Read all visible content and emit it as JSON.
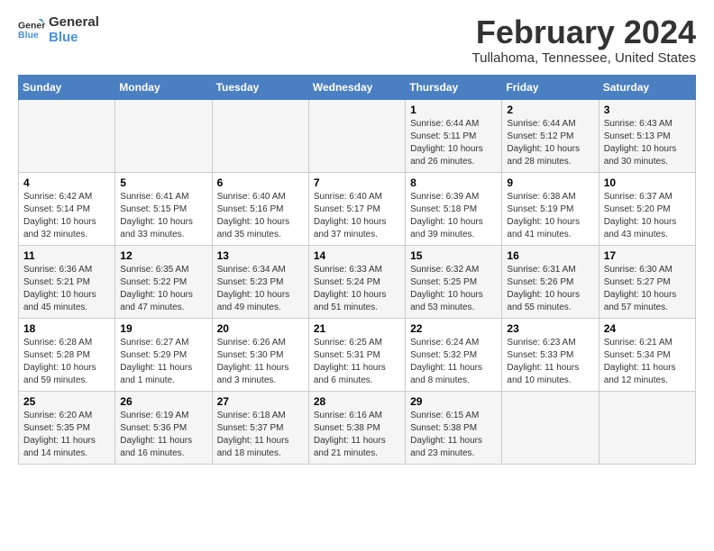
{
  "logo": {
    "text_general": "General",
    "text_blue": "Blue"
  },
  "header": {
    "title": "February 2024",
    "subtitle": "Tullahoma, Tennessee, United States"
  },
  "columns": [
    "Sunday",
    "Monday",
    "Tuesday",
    "Wednesday",
    "Thursday",
    "Friday",
    "Saturday"
  ],
  "weeks": [
    [
      {
        "day": "",
        "info": ""
      },
      {
        "day": "",
        "info": ""
      },
      {
        "day": "",
        "info": ""
      },
      {
        "day": "",
        "info": ""
      },
      {
        "day": "1",
        "info": "Sunrise: 6:44 AM\nSunset: 5:11 PM\nDaylight: 10 hours\nand 26 minutes."
      },
      {
        "day": "2",
        "info": "Sunrise: 6:44 AM\nSunset: 5:12 PM\nDaylight: 10 hours\nand 28 minutes."
      },
      {
        "day": "3",
        "info": "Sunrise: 6:43 AM\nSunset: 5:13 PM\nDaylight: 10 hours\nand 30 minutes."
      }
    ],
    [
      {
        "day": "4",
        "info": "Sunrise: 6:42 AM\nSunset: 5:14 PM\nDaylight: 10 hours\nand 32 minutes."
      },
      {
        "day": "5",
        "info": "Sunrise: 6:41 AM\nSunset: 5:15 PM\nDaylight: 10 hours\nand 33 minutes."
      },
      {
        "day": "6",
        "info": "Sunrise: 6:40 AM\nSunset: 5:16 PM\nDaylight: 10 hours\nand 35 minutes."
      },
      {
        "day": "7",
        "info": "Sunrise: 6:40 AM\nSunset: 5:17 PM\nDaylight: 10 hours\nand 37 minutes."
      },
      {
        "day": "8",
        "info": "Sunrise: 6:39 AM\nSunset: 5:18 PM\nDaylight: 10 hours\nand 39 minutes."
      },
      {
        "day": "9",
        "info": "Sunrise: 6:38 AM\nSunset: 5:19 PM\nDaylight: 10 hours\nand 41 minutes."
      },
      {
        "day": "10",
        "info": "Sunrise: 6:37 AM\nSunset: 5:20 PM\nDaylight: 10 hours\nand 43 minutes."
      }
    ],
    [
      {
        "day": "11",
        "info": "Sunrise: 6:36 AM\nSunset: 5:21 PM\nDaylight: 10 hours\nand 45 minutes."
      },
      {
        "day": "12",
        "info": "Sunrise: 6:35 AM\nSunset: 5:22 PM\nDaylight: 10 hours\nand 47 minutes."
      },
      {
        "day": "13",
        "info": "Sunrise: 6:34 AM\nSunset: 5:23 PM\nDaylight: 10 hours\nand 49 minutes."
      },
      {
        "day": "14",
        "info": "Sunrise: 6:33 AM\nSunset: 5:24 PM\nDaylight: 10 hours\nand 51 minutes."
      },
      {
        "day": "15",
        "info": "Sunrise: 6:32 AM\nSunset: 5:25 PM\nDaylight: 10 hours\nand 53 minutes."
      },
      {
        "day": "16",
        "info": "Sunrise: 6:31 AM\nSunset: 5:26 PM\nDaylight: 10 hours\nand 55 minutes."
      },
      {
        "day": "17",
        "info": "Sunrise: 6:30 AM\nSunset: 5:27 PM\nDaylight: 10 hours\nand 57 minutes."
      }
    ],
    [
      {
        "day": "18",
        "info": "Sunrise: 6:28 AM\nSunset: 5:28 PM\nDaylight: 10 hours\nand 59 minutes."
      },
      {
        "day": "19",
        "info": "Sunrise: 6:27 AM\nSunset: 5:29 PM\nDaylight: 11 hours\nand 1 minute."
      },
      {
        "day": "20",
        "info": "Sunrise: 6:26 AM\nSunset: 5:30 PM\nDaylight: 11 hours\nand 3 minutes."
      },
      {
        "day": "21",
        "info": "Sunrise: 6:25 AM\nSunset: 5:31 PM\nDaylight: 11 hours\nand 6 minutes."
      },
      {
        "day": "22",
        "info": "Sunrise: 6:24 AM\nSunset: 5:32 PM\nDaylight: 11 hours\nand 8 minutes."
      },
      {
        "day": "23",
        "info": "Sunrise: 6:23 AM\nSunset: 5:33 PM\nDaylight: 11 hours\nand 10 minutes."
      },
      {
        "day": "24",
        "info": "Sunrise: 6:21 AM\nSunset: 5:34 PM\nDaylight: 11 hours\nand 12 minutes."
      }
    ],
    [
      {
        "day": "25",
        "info": "Sunrise: 6:20 AM\nSunset: 5:35 PM\nDaylight: 11 hours\nand 14 minutes."
      },
      {
        "day": "26",
        "info": "Sunrise: 6:19 AM\nSunset: 5:36 PM\nDaylight: 11 hours\nand 16 minutes."
      },
      {
        "day": "27",
        "info": "Sunrise: 6:18 AM\nSunset: 5:37 PM\nDaylight: 11 hours\nand 18 minutes."
      },
      {
        "day": "28",
        "info": "Sunrise: 6:16 AM\nSunset: 5:38 PM\nDaylight: 11 hours\nand 21 minutes."
      },
      {
        "day": "29",
        "info": "Sunrise: 6:15 AM\nSunset: 5:38 PM\nDaylight: 11 hours\nand 23 minutes."
      },
      {
        "day": "",
        "info": ""
      },
      {
        "day": "",
        "info": ""
      }
    ]
  ]
}
